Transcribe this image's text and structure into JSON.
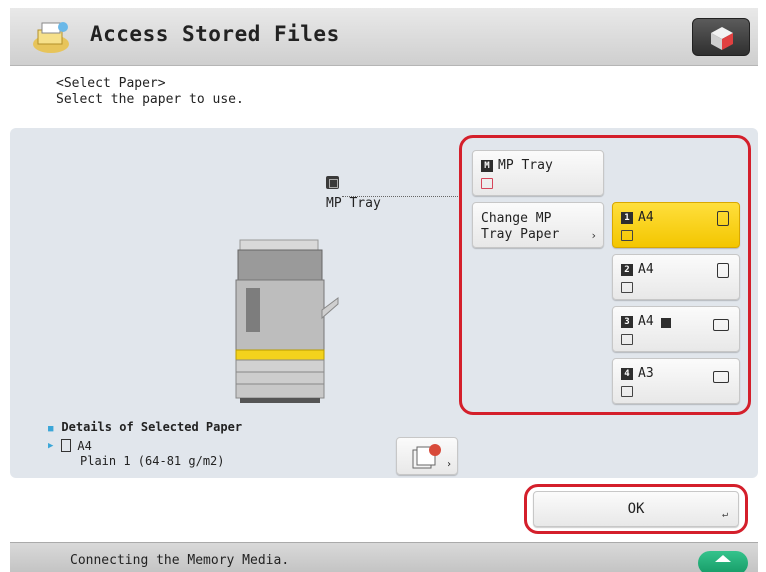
{
  "header": {
    "title": "Access Stored Files",
    "app_icon": "stored-files-icon",
    "right_button_icon": "cube-icon"
  },
  "instructions": {
    "line1": "<Select Paper>",
    "line2": "Select the paper to use."
  },
  "diagram": {
    "marker_label": "MP Tray"
  },
  "sources": {
    "mp_tray": {
      "num": "M",
      "label": "MP Tray"
    },
    "change_mp": {
      "line1": "Change MP",
      "line2": "Tray Paper"
    },
    "drawers": [
      {
        "num": "1",
        "label": "A4",
        "selected": true
      },
      {
        "num": "2",
        "label": "A4",
        "selected": false
      },
      {
        "num": "3",
        "label": "A4",
        "selected": false
      },
      {
        "num": "4",
        "label": "A3",
        "selected": false
      }
    ]
  },
  "details": {
    "title": "Details of Selected Paper",
    "size": "A4",
    "type": "Plain 1 (64-81 g/m2)"
  },
  "ok_label": "OK",
  "status": {
    "message": "Connecting the Memory Media."
  },
  "colors": {
    "highlight": "#d41f2b",
    "selected": "#f5c800",
    "panel": "#e1e6ec",
    "eject": "#1fae74"
  }
}
